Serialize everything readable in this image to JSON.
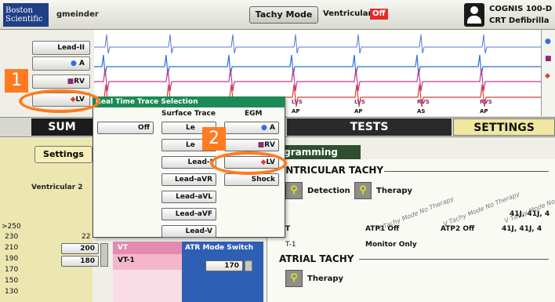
{
  "header": {
    "logo": "Boston Scientific",
    "user": "gmeinder",
    "tachy_mode": "Tachy Mode",
    "ventricular_label": "Ventricular:",
    "ventricular_status": "Off",
    "device_line1": "COGNIS 100-D",
    "device_line2": "CRT Defibrilla"
  },
  "leads": [
    "Lead-II",
    "A",
    "RV",
    "LV"
  ],
  "markers": [
    "LVS",
    "AP",
    "RVS",
    "AS"
  ],
  "callouts": [
    "1",
    "2"
  ],
  "tabs": {
    "summary": "SUM",
    "tests": "TESTS",
    "settings": "SETTINGS"
  },
  "left": {
    "settings_button": "Settings",
    "ventricular_label": "Ventricular 2"
  },
  "popup": {
    "title": "Real Time Trace Selection",
    "surface_trace": "Surface Trace",
    "egm": "EGM",
    "off": "Off",
    "surface_options": [
      "Le",
      "Le",
      "Lead-I",
      "Lead-aVR",
      "Lead-aVL",
      "Lead-aVF",
      "Lead-V"
    ],
    "egm_options": [
      "A",
      "RV",
      "LV",
      "Shock"
    ]
  },
  "programming": {
    "tab": "rogramming",
    "ventricular_tachy": "ENTRICULAR TACHY",
    "detection": "Detection",
    "therapy": "Therapy",
    "watermark": "V Tachy Mode No Therapy",
    "row_vt": "T",
    "atp1": "ATP1 Off",
    "atp2": "ATP2 Off",
    "vals1": "41J, 41J, 4",
    "vals2": "41J, 41J, 4",
    "row_vt1": "T-1",
    "monitor_only": "Monitor Only",
    "atrial_tachy": "ATRIAL TACHY",
    "atrial_therapy": "Therapy"
  },
  "zones": {
    "scale": [
      ">250",
      "230",
      "210",
      "190",
      "170",
      "150",
      "130"
    ],
    "val_22": "22",
    "val_200": "200",
    "val_180": "180",
    "vt": "VT",
    "vt1": "VT-1",
    "atr_mode_switch": "ATR Mode Switch",
    "atr_value": "170"
  },
  "colors": {
    "accent_orange": "#ff7a21",
    "title_green": "#1c8a57",
    "atrial_blue": "#2f6de0",
    "rv_purple": "#8a2a72",
    "lv_red": "#e03b3b"
  }
}
